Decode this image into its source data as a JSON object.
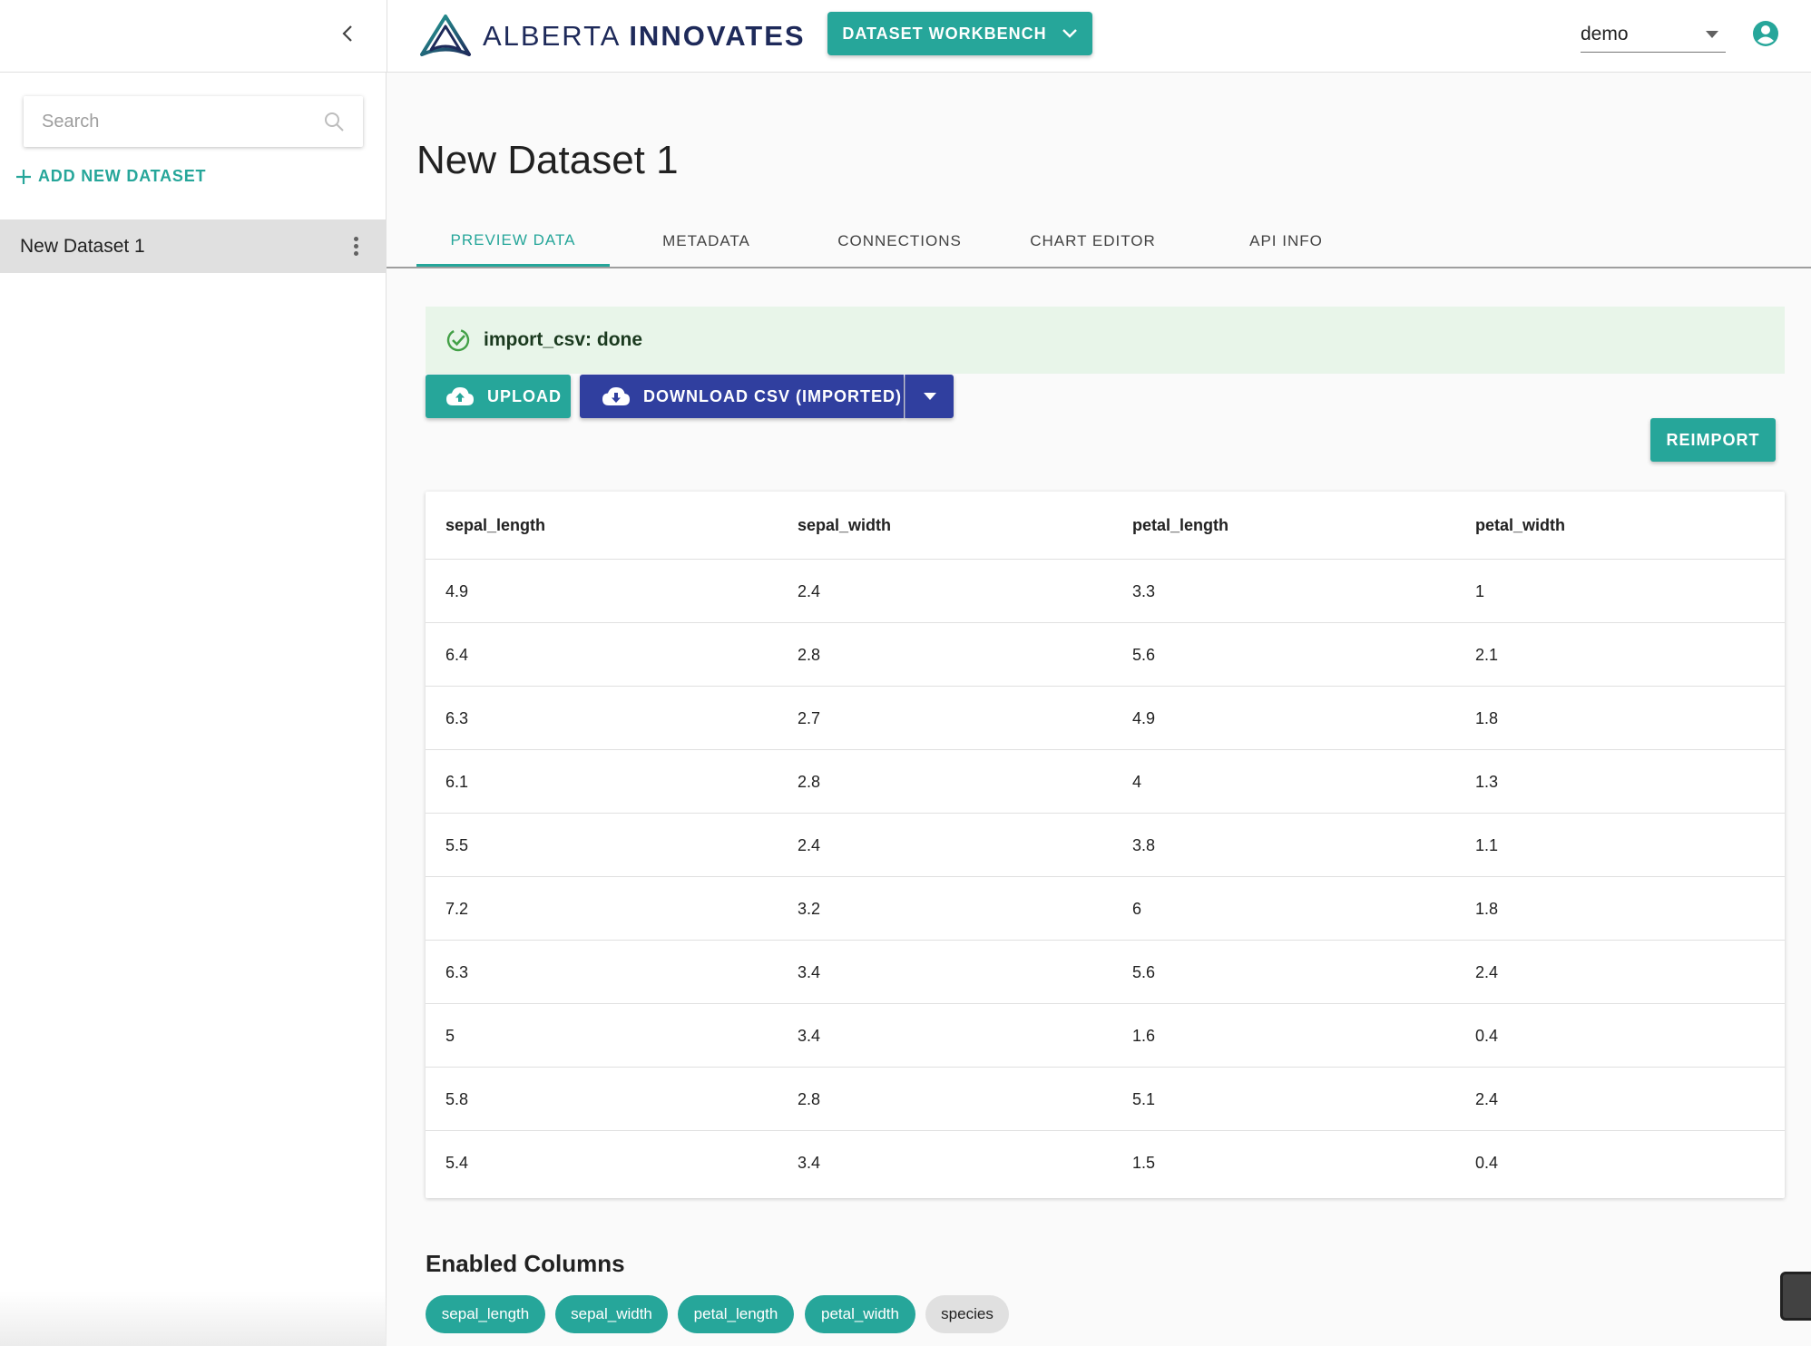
{
  "header": {
    "logo_light": "ALBERTA ",
    "logo_bold": "INNOVATES",
    "workbench_label": "DATASET WORKBENCH",
    "user_value": "demo"
  },
  "sidebar": {
    "search_placeholder": "Search",
    "add_label": "ADD NEW DATASET",
    "items": [
      {
        "label": "New Dataset 1"
      }
    ]
  },
  "main": {
    "title": "New Dataset 1",
    "tabs": [
      {
        "label": "PREVIEW DATA"
      },
      {
        "label": "METADATA"
      },
      {
        "label": "CONNECTIONS"
      },
      {
        "label": "CHART EDITOR"
      },
      {
        "label": "API INFO"
      }
    ],
    "active_tab": "PREVIEW DATA",
    "status_text": "import_csv: done",
    "upload_label": "UPLOAD",
    "download_label": "DOWNLOAD CSV (IMPORTED)",
    "reimport_label": "REIMPORT",
    "table": {
      "headers": [
        "sepal_length",
        "sepal_width",
        "petal_length",
        "petal_width"
      ],
      "rows": [
        [
          "4.9",
          "2.4",
          "3.3",
          "1"
        ],
        [
          "6.4",
          "2.8",
          "5.6",
          "2.1"
        ],
        [
          "6.3",
          "2.7",
          "4.9",
          "1.8"
        ],
        [
          "6.1",
          "2.8",
          "4",
          "1.3"
        ],
        [
          "5.5",
          "2.4",
          "3.8",
          "1.1"
        ],
        [
          "7.2",
          "3.2",
          "6",
          "1.8"
        ],
        [
          "6.3",
          "3.4",
          "5.6",
          "2.4"
        ],
        [
          "5",
          "3.4",
          "1.6",
          "0.4"
        ],
        [
          "5.8",
          "2.8",
          "5.1",
          "2.4"
        ],
        [
          "5.4",
          "3.4",
          "1.5",
          "0.4"
        ]
      ]
    },
    "enabled_title": "Enabled Columns",
    "chips": [
      {
        "label": "sepal_length",
        "enabled": true
      },
      {
        "label": "sepal_width",
        "enabled": true
      },
      {
        "label": "petal_length",
        "enabled": true
      },
      {
        "label": "petal_width",
        "enabled": true
      },
      {
        "label": "species",
        "enabled": false
      }
    ]
  },
  "colors": {
    "accent": "#26a69a",
    "primary": "#303f9f",
    "logo": "#1e2a5a",
    "success_bg": "#e8f5e9",
    "success_icon": "#43a047"
  },
  "icons": {
    "collapse": "chevron-left-icon",
    "logo": "alberta-innovates-logo-icon",
    "workbench_dropdown": "chevron-down-icon",
    "user_dropdown": "caret-down-icon",
    "user": "account-circle-icon",
    "search": "search-icon",
    "add": "plus-icon",
    "item_menu": "more-vert-icon",
    "status": "check-circle-icon",
    "upload": "cloud-upload-icon",
    "download": "cloud-download-icon",
    "download_menu": "caret-down-icon"
  }
}
